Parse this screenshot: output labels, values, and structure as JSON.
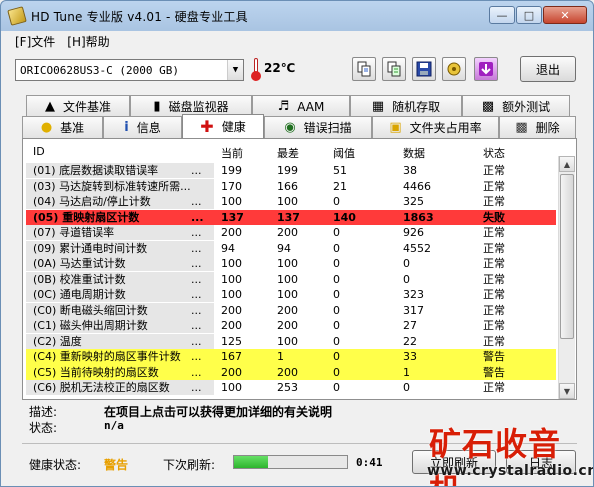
{
  "window": {
    "title": "HD Tune 专业版 v4.01 - 硬盘专业工具"
  },
  "menu": {
    "file": "[F]文件",
    "help": "[H]帮助"
  },
  "toolbar": {
    "drive": "ORICO0628US3-C (2000 GB)",
    "temperature": "22℃",
    "exit_label": "退出"
  },
  "tabs_top": [
    {
      "label": "文件基准",
      "icon": "file-benchmark-icon"
    },
    {
      "label": "磁盘监视器",
      "icon": "disk-monitor-icon"
    },
    {
      "label": "AAM",
      "icon": "speaker-icon"
    },
    {
      "label": "随机存取",
      "icon": "random-access-icon"
    },
    {
      "label": "额外测试",
      "icon": "extra-tests-icon"
    }
  ],
  "tabs_bottom": [
    {
      "label": "基准",
      "icon": "lightbulb-icon"
    },
    {
      "label": "信息",
      "icon": "info-icon"
    },
    {
      "label": "健康",
      "icon": "health-cross-icon"
    },
    {
      "label": "错误扫描",
      "icon": "error-scan-icon"
    },
    {
      "label": "文件夹占用率",
      "icon": "folder-icon"
    },
    {
      "label": "删除",
      "icon": "trash-icon"
    }
  ],
  "table": {
    "headers": [
      "ID",
      "当前",
      "最差",
      "阈值",
      "数据",
      "状态"
    ],
    "rows": [
      {
        "name": "(01) 底层数据读取错误率",
        "dots": "...",
        "cur": "199",
        "worst": "199",
        "thr": "51",
        "data": "38",
        "status": "正常",
        "hl": ""
      },
      {
        "name": "(03) 马达旋转到标准转速所需...",
        "dots": "",
        "cur": "170",
        "worst": "166",
        "thr": "21",
        "data": "4466",
        "status": "正常",
        "hl": ""
      },
      {
        "name": "(04) 马达启动/停止计数",
        "dots": "...",
        "cur": "100",
        "worst": "100",
        "thr": "0",
        "data": "325",
        "status": "正常",
        "hl": ""
      },
      {
        "name": "(05) 重映射扇区计数",
        "dots": "...",
        "cur": "137",
        "worst": "137",
        "thr": "140",
        "data": "1863",
        "status": "失败",
        "hl": "red"
      },
      {
        "name": "(07) 寻道错误率",
        "dots": "...",
        "cur": "200",
        "worst": "200",
        "thr": "0",
        "data": "926",
        "status": "正常",
        "hl": ""
      },
      {
        "name": "(09) 累计通电时间计数",
        "dots": "...",
        "cur": "94",
        "worst": "94",
        "thr": "0",
        "data": "4552",
        "status": "正常",
        "hl": ""
      },
      {
        "name": "(0A) 马达重试计数",
        "dots": "...",
        "cur": "100",
        "worst": "100",
        "thr": "0",
        "data": "0",
        "status": "正常",
        "hl": ""
      },
      {
        "name": "(0B) 校准重试计数",
        "dots": "...",
        "cur": "100",
        "worst": "100",
        "thr": "0",
        "data": "0",
        "status": "正常",
        "hl": ""
      },
      {
        "name": "(0C) 通电周期计数",
        "dots": "...",
        "cur": "100",
        "worst": "100",
        "thr": "0",
        "data": "323",
        "status": "正常",
        "hl": ""
      },
      {
        "name": "(C0) 断电磁头缩回计数",
        "dots": "...",
        "cur": "200",
        "worst": "200",
        "thr": "0",
        "data": "317",
        "status": "正常",
        "hl": ""
      },
      {
        "name": "(C1) 磁头伸出周期计数",
        "dots": "...",
        "cur": "200",
        "worst": "200",
        "thr": "0",
        "data": "27",
        "status": "正常",
        "hl": ""
      },
      {
        "name": "(C2) 温度",
        "dots": "...",
        "cur": "125",
        "worst": "100",
        "thr": "0",
        "data": "22",
        "status": "正常",
        "hl": ""
      },
      {
        "name": "(C4) 重新映射的扇区事件计数",
        "dots": "...",
        "cur": "167",
        "worst": "1",
        "thr": "0",
        "data": "33",
        "status": "警告",
        "hl": "yellow"
      },
      {
        "name": "(C5) 当前待映射的扇区数",
        "dots": "...",
        "cur": "200",
        "worst": "200",
        "thr": "0",
        "data": "1",
        "status": "警告",
        "hl": "yellow"
      },
      {
        "name": "(C6) 脱机无法校正的扇区数",
        "dots": "...",
        "cur": "100",
        "worst": "253",
        "thr": "0",
        "data": "0",
        "status": "正常",
        "hl": ""
      }
    ]
  },
  "details": {
    "desc_label": "描述:",
    "desc_value": "在项目上点击可以获得更加详细的有关说明",
    "state_label": "状态:",
    "state_value": "n/a"
  },
  "footer": {
    "health_label": "健康状态:",
    "health_value": "警告",
    "next_label": "下次刷新:",
    "progress_fraction": 0.3,
    "countdown": "0:41",
    "refresh_label": "立即刷新",
    "log_label": "日志"
  },
  "watermark": {
    "big": "矿石收音机",
    "small": "www.crystalradio.cn"
  },
  "colors": {
    "fail_row": "#ff3a3a",
    "warn_row": "#ffff4a",
    "warn_text": "#e8a000",
    "watermark": "#d81e06"
  }
}
